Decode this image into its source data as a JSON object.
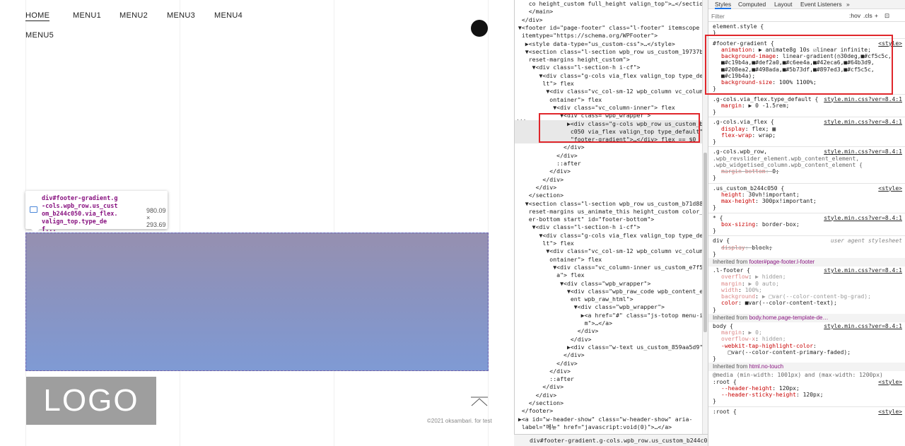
{
  "page": {
    "menu": [
      "HOME",
      "MENU1",
      "MENU2",
      "MENU3",
      "MENU4",
      "MENU5"
    ],
    "tooltip": {
      "selector": "div#footer-gradient.g-cols.wpb_row.us_custom_b244c050.via_flex.valign_top.type_def...",
      "size": "980.09 × 293.69"
    },
    "logo": "LOGO",
    "copyright": "©2021 oksambari. for test"
  },
  "elements": {
    "lines": [
      "    co height_custom full_height valign_top\">…</section>",
      "    </main>",
      "  </div>",
      " ▼<footer id=\"page-footer\" class=\"l-footer\" itemscope",
      "  itemtype=\"https://schema.org/WPFooter\">",
      "   ▶<style data-type=\"us_custom-css\">…</style>",
      "   ▼<section class=\"l-section wpb_row us_custom_19737bc8",
      "    reset-margins height_custom\">",
      "     ▼<div class=\"l-section-h i-cf\">",
      "       ▼<div class=\"g-cols via_flex valign_top type_defau",
      "        lt\"> flex",
      "         ▼<div class=\"vc_col-sm-12 wpb_column vc_column_c",
      "          ontainer\"> flex",
      "           ▼<div class=\"vc_column-inner\"> flex",
      "             ▼<div class=\"wpb_wrapper\">",
      "               ▶<div class=\"g-cols wpb_row us_custom_b244",
      "                c050 via_flex valign_top type_default\" id=",
      "                \"footer-gradient\">…</div> flex == $0",
      "              </div>",
      "            </div>",
      "            ::after",
      "          </div>",
      "        </div>",
      "      </div>",
      "    </section>",
      "   ▼<section class=\"l-section wpb_row us_custom_b71d88c9",
      "    reset-margins us_animate_this height_custom color_foot",
      "    er-bottom start\" id=\"footer-bottom\">",
      "     ▼<div class=\"l-section-h i-cf\">",
      "       ▼<div class=\"g-cols via_flex valign_top type_defau",
      "        lt\"> flex",
      "         ▼<div class=\"vc_col-sm-12 wpb_column vc_column_c",
      "          ontainer\"> flex",
      "           ▼<div class=\"vc_column-inner us_custom_e7f5d98",
      "            a\"> flex",
      "             ▼<div class=\"wpb_wrapper\">",
      "               ▼<div class=\"wpb_raw_code wpb_content_elem",
      "                ent wpb_raw_html\">",
      "                 ▼<div class=\"wpb_wrapper\">",
      "                   ▶<a href=\"#\" class=\"js-totop menu-ite",
      "                    m\">…</a>",
      "                  </div>",
      "                </div>",
      "               ▶<div class=\"w-text us_custom_859aa5d9\">…",
      "              </div>",
      "            </div>",
      "          </div>",
      "          ::after",
      "        </div>",
      "      </div>",
      "    </section>",
      "  </footer>",
      " ▶<a id=\"w-header-show\" class=\"w-header-show\" aria-",
      "  label=\"메뉴\" href=\"javascript:void(0)\">…</a>"
    ],
    "breadcrumb": "div#footer-gradient.g-cols.wpb_row.us_custom_b244c050.via_flex.v"
  },
  "styles": {
    "tabs": [
      "Styles",
      "Computed",
      "Layout",
      "Event Listeners",
      "»"
    ],
    "filter_placeholder": "Filter",
    "tools": [
      ":hov",
      ".cls",
      "+"
    ],
    "lines": [
      {
        "t": "sel",
        "text": "element.style {"
      },
      {
        "t": "sel",
        "text": "}"
      },
      {
        "t": "sep"
      },
      {
        "t": "sel",
        "text": "#footer-gradient {",
        "src": "<style>"
      },
      {
        "t": "decl",
        "p": "animation",
        "v": "▶ animate8g 10s ☑linear infinite;"
      },
      {
        "t": "decl",
        "p": "background-image",
        "v": "linear-gradient(◷30deg,■#cf5c5c,"
      },
      {
        "t": "cont",
        "v": "■#c19b4a,■#def2a0,■#c6ee4a,■#42eca6,■#64b3d9,"
      },
      {
        "t": "cont",
        "v": "■#208ea2,■#498ada,■#5b73df,■#897ed3,■#cf5c5c,"
      },
      {
        "t": "cont",
        "v": "■#c19b4a);"
      },
      {
        "t": "decl",
        "p": "background-size",
        "v": "100% 1100%;"
      },
      {
        "t": "sel",
        "text": "}"
      },
      {
        "t": "sep"
      },
      {
        "t": "sel",
        "text": ".g-cols.via_flex.type_default {",
        "src": "style.min.css?ver=8.4:1"
      },
      {
        "t": "decl",
        "p": "margin",
        "v": "▶ 0 -1.5rem;"
      },
      {
        "t": "sel",
        "text": "}"
      },
      {
        "t": "sep"
      },
      {
        "t": "sel",
        "text": ".g-cols.via_flex {",
        "src": "style.min.css?ver=8.4:1"
      },
      {
        "t": "decl",
        "p": "display",
        "v": "flex; ▦"
      },
      {
        "t": "decl",
        "p": "flex-wrap",
        "v": "wrap;"
      },
      {
        "t": "sel",
        "text": "}"
      },
      {
        "t": "sep"
      },
      {
        "t": "sel",
        "text": ".g-cols.wpb_row,",
        "src": "style.min.css?ver=8.4:1"
      },
      {
        "t": "cmt",
        "text": ".wpb_revslider_element.wpb_content_element,"
      },
      {
        "t": "cmt",
        "text": ".wpb_widgetised_column.wpb_content_element {"
      },
      {
        "t": "strike",
        "p": "margin-bottom",
        "v": "0;"
      },
      {
        "t": "sel",
        "text": "}"
      },
      {
        "t": "sep"
      },
      {
        "t": "sel",
        "text": ".us_custom_b244c050 {",
        "src": "<style>"
      },
      {
        "t": "decl",
        "p": "height",
        "v": "30vh!important;"
      },
      {
        "t": "decl",
        "p": "max-height",
        "v": "300px!important;"
      },
      {
        "t": "sel",
        "text": "}"
      },
      {
        "t": "sep"
      },
      {
        "t": "sel",
        "text": "* {",
        "src": "style.min.css?ver=8.4:1"
      },
      {
        "t": "decl",
        "p": "box-sizing",
        "v": "border-box;"
      },
      {
        "t": "sel",
        "text": "}"
      },
      {
        "t": "sep"
      },
      {
        "t": "sel",
        "text": "div {",
        "uas": "user agent stylesheet"
      },
      {
        "t": "strike",
        "p": "display",
        "v": "block;"
      },
      {
        "t": "sel",
        "text": "}"
      },
      {
        "t": "inh",
        "text": "Inherited from ",
        "el": "footer#page-footer.l-footer"
      },
      {
        "t": "sel",
        "text": ".l-footer {",
        "src": "style.min.css?ver=8.4:1"
      },
      {
        "t": "faded",
        "p": "overflow",
        "v": "▶ hidden;"
      },
      {
        "t": "faded",
        "p": "margin",
        "v": "▶ 0 auto;"
      },
      {
        "t": "faded",
        "p": "width",
        "v": "100%;"
      },
      {
        "t": "faded",
        "p": "background",
        "v": "▶ □var(--color-content-bg-grad);"
      },
      {
        "t": "decl",
        "p": "color",
        "v": "■var(--color-content-text);"
      },
      {
        "t": "sel",
        "text": "}"
      },
      {
        "t": "inh",
        "text": "Inherited from ",
        "el": "body.home.page-template-de…"
      },
      {
        "t": "sel",
        "text": "body {",
        "src": "style.min.css?ver=8.4:1"
      },
      {
        "t": "faded",
        "p": "margin",
        "v": "▶ 0;"
      },
      {
        "t": "faded",
        "p": "overflow-x",
        "v": "hidden;"
      },
      {
        "t": "decl",
        "p": "-webkit-tap-highlight-color",
        "v": ""
      },
      {
        "t": "cont",
        "v": "  □var(--color-content-primary-faded);"
      },
      {
        "t": "sel",
        "text": "}"
      },
      {
        "t": "inh",
        "text": "Inherited from ",
        "el": "html.no-touch"
      },
      {
        "t": "cmt",
        "text": "@media (min-width: 1001px) and (max-width: 1200px)"
      },
      {
        "t": "sel",
        "text": ":root {",
        "src": "<style>"
      },
      {
        "t": "decl",
        "p": "--header-height",
        "v": "120px;"
      },
      {
        "t": "decl",
        "p": "--header-sticky-height",
        "v": "120px;"
      },
      {
        "t": "sel",
        "text": "}"
      },
      {
        "t": "sep"
      },
      {
        "t": "sel",
        "text": ":root {",
        "src": "<style>"
      }
    ]
  },
  "colors": {
    "highlight_box": "#e0262b",
    "accent": "#1a73e8"
  }
}
